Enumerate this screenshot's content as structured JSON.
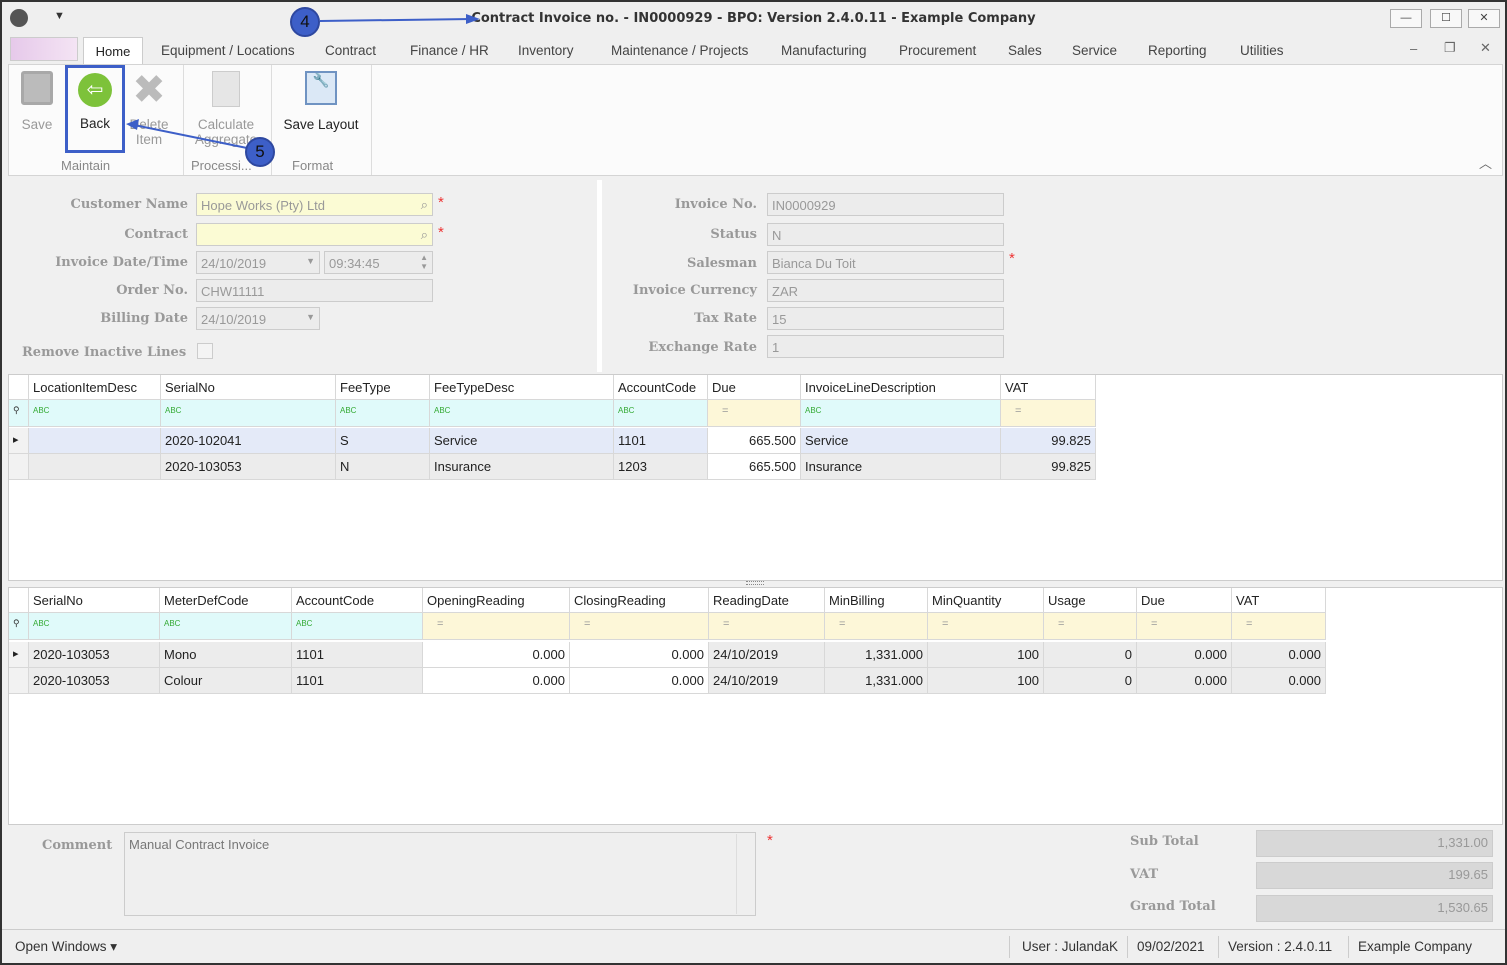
{
  "window": {
    "title": "Contract Invoice no. - IN0000929 - BPO: Version 2.4.0.11 - Example Company",
    "minimize": "—",
    "maximize": "☐",
    "close": "✕"
  },
  "tabs": [
    "Home",
    "Equipment / Locations",
    "Contract",
    "Finance / HR",
    "Inventory",
    "Maintenance / Projects",
    "Manufacturing",
    "Procurement",
    "Sales",
    "Service",
    "Reporting",
    "Utilities"
  ],
  "ribbon": {
    "save": "Save",
    "back": "Back",
    "delete": "Delete Item",
    "calculate": "Calculate Aggregate",
    "save_layout": "Save Layout",
    "groups": {
      "maintain": "Maintain",
      "processing": "Processi...",
      "format": "Format"
    }
  },
  "annotations": {
    "a4": "4",
    "a5": "5",
    "color": "#3d5fc8"
  },
  "form": {
    "customer_name_label": "Customer Name",
    "customer_name": "Hope Works (Pty) Ltd",
    "contract_label": "Contract",
    "contract": "",
    "invoice_datetime_label": "Invoice Date/Time",
    "invoice_date": "24/10/2019",
    "invoice_time": "09:34:45",
    "order_no_label": "Order No.",
    "order_no": "CHW11111",
    "billing_date_label": "Billing Date",
    "billing_date": "24/10/2019",
    "remove_inactive_label": "Remove Inactive Lines",
    "remove_inactive": false,
    "invoice_no_label": "Invoice No.",
    "invoice_no": "IN0000929",
    "status_label": "Status",
    "status": "N",
    "salesman_label": "Salesman",
    "salesman": "Bianca Du Toit",
    "currency_label": "Invoice Currency",
    "currency": "ZAR",
    "tax_rate_label": "Tax Rate",
    "tax_rate": "15",
    "exchange_rate_label": "Exchange Rate",
    "exchange_rate": "1",
    "required": "*"
  },
  "grid1": {
    "columns": [
      "LocationItemDesc",
      "SerialNo",
      "FeeType",
      "FeeTypeDesc",
      "AccountCode",
      "Due",
      "InvoiceLineDescription",
      "VAT"
    ],
    "filters": [
      "ABC",
      "ABC",
      "ABC",
      "ABC",
      "ABC",
      "=",
      "ABC",
      "="
    ],
    "rows": [
      [
        "",
        "2020-102041",
        "S",
        "Service",
        "1101",
        "665.500",
        "Service",
        "99.825"
      ],
      [
        "",
        "2020-103053",
        "N",
        "Insurance",
        "1203",
        "665.500",
        "Insurance",
        "99.825"
      ]
    ]
  },
  "grid2": {
    "columns": [
      "SerialNo",
      "MeterDefCode",
      "AccountCode",
      "OpeningReading",
      "ClosingReading",
      "ReadingDate",
      "MinBilling",
      "MinQuantity",
      "Usage",
      "Due",
      "VAT"
    ],
    "filters": [
      "ABC",
      "ABC",
      "ABC",
      "=",
      "=",
      "=",
      "=",
      "=",
      "=",
      "=",
      "="
    ],
    "rows": [
      [
        "2020-103053",
        "Mono",
        "1101",
        "0.000",
        "0.000",
        "24/10/2019",
        "1,331.000",
        "100",
        "0",
        "0.000",
        "0.000"
      ],
      [
        "2020-103053",
        "Colour",
        "1101",
        "0.000",
        "0.000",
        "24/10/2019",
        "1,331.000",
        "100",
        "0",
        "0.000",
        "0.000"
      ]
    ]
  },
  "footer": {
    "comment_label": "Comment",
    "comment": "Manual Contract Invoice",
    "sub_total_label": "Sub Total",
    "sub_total": "1,331.00",
    "vat_label": "VAT",
    "vat": "199.65",
    "grand_total_label": "Grand Total",
    "grand_total": "1,530.65"
  },
  "status": {
    "open_windows": "Open Windows ▾",
    "user": "User : JulandaK",
    "date": "09/02/2021",
    "version": "Version : 2.4.0.11",
    "company": "Example Company"
  }
}
